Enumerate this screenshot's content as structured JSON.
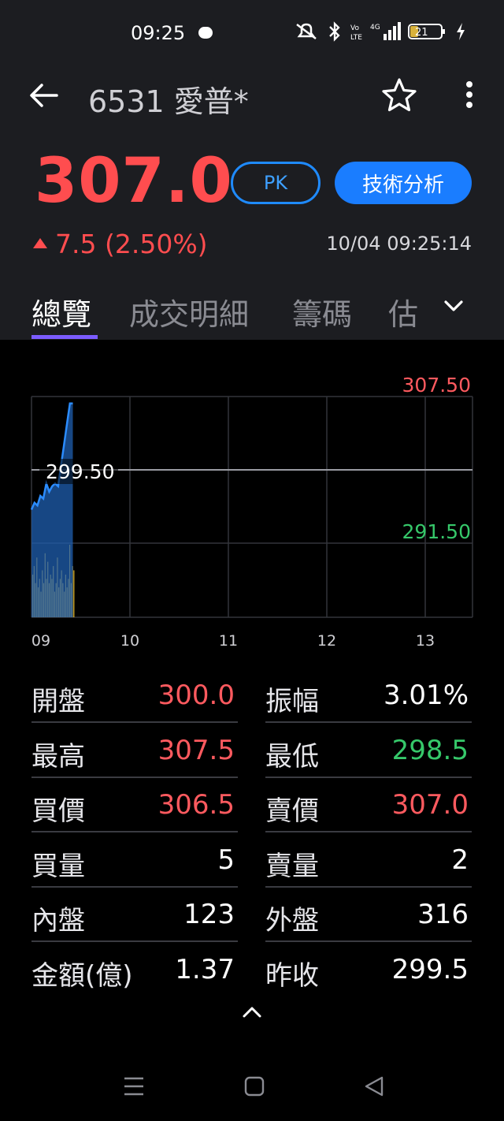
{
  "status": {
    "time": "09:25",
    "battery": "21"
  },
  "stock": {
    "code_name": "6531 愛普*",
    "price": "307.0",
    "change": "7.5 (2.50%)",
    "timestamp": "10/04 09:25:14",
    "pk_label": "PK",
    "ta_label": "技術分析"
  },
  "tabs": [
    "總覽",
    "成交明細",
    "籌碼",
    "估"
  ],
  "chart_data": {
    "type": "line",
    "x_labels": [
      "09",
      "10",
      "11",
      "12",
      "13"
    ],
    "price_high_label": "307.50",
    "price_ref_label": "299.50",
    "price_low_label": "291.50",
    "ylim": [
      291.5,
      307.5
    ],
    "series": [
      {
        "x": [
          0.0,
          0.03,
          0.06,
          0.09,
          0.12,
          0.15,
          0.18,
          0.21,
          0.24,
          0.27,
          0.3,
          0.33,
          0.36,
          0.39,
          0.42
        ],
        "values": [
          299.3,
          299.8,
          299.6,
          300.3,
          300.1,
          301.2,
          300.6,
          301.0,
          301.2,
          301.0,
          302.5,
          304.0,
          305.5,
          307.0,
          307.0
        ]
      }
    ],
    "volume": [
      10,
      12,
      8,
      14,
      7,
      9,
      6,
      11,
      8,
      15,
      9,
      13,
      8,
      10,
      9,
      12,
      6,
      8,
      14,
      7,
      9,
      11,
      8,
      6,
      10,
      7,
      9,
      17,
      8,
      12,
      11
    ]
  },
  "stats": {
    "left": [
      {
        "label": "開盤",
        "value": "300.0",
        "color": "red"
      },
      {
        "label": "最高",
        "value": "307.5",
        "color": "red"
      },
      {
        "label": "買價",
        "value": "306.5",
        "color": "red"
      },
      {
        "label": "買量",
        "value": "5",
        "color": "white"
      },
      {
        "label": "內盤",
        "value": "123",
        "color": "white"
      },
      {
        "label": "金額(億)",
        "value": "1.37",
        "color": "white"
      }
    ],
    "right": [
      {
        "label": "振幅",
        "value": "3.01%",
        "color": "white"
      },
      {
        "label": "最低",
        "value": "298.5",
        "color": "green"
      },
      {
        "label": "賣價",
        "value": "307.0",
        "color": "red"
      },
      {
        "label": "賣量",
        "value": "2",
        "color": "white"
      },
      {
        "label": "外盤",
        "value": "316",
        "color": "white"
      },
      {
        "label": "昨收",
        "value": "299.5",
        "color": "white"
      }
    ]
  },
  "colors": {
    "up": "#ff4d4f",
    "down": "#36c86a",
    "accent": "#1a7dff",
    "tab_indicator": "#7b5cff",
    "volume": "#f2c12e",
    "line": "#2b8cff"
  }
}
